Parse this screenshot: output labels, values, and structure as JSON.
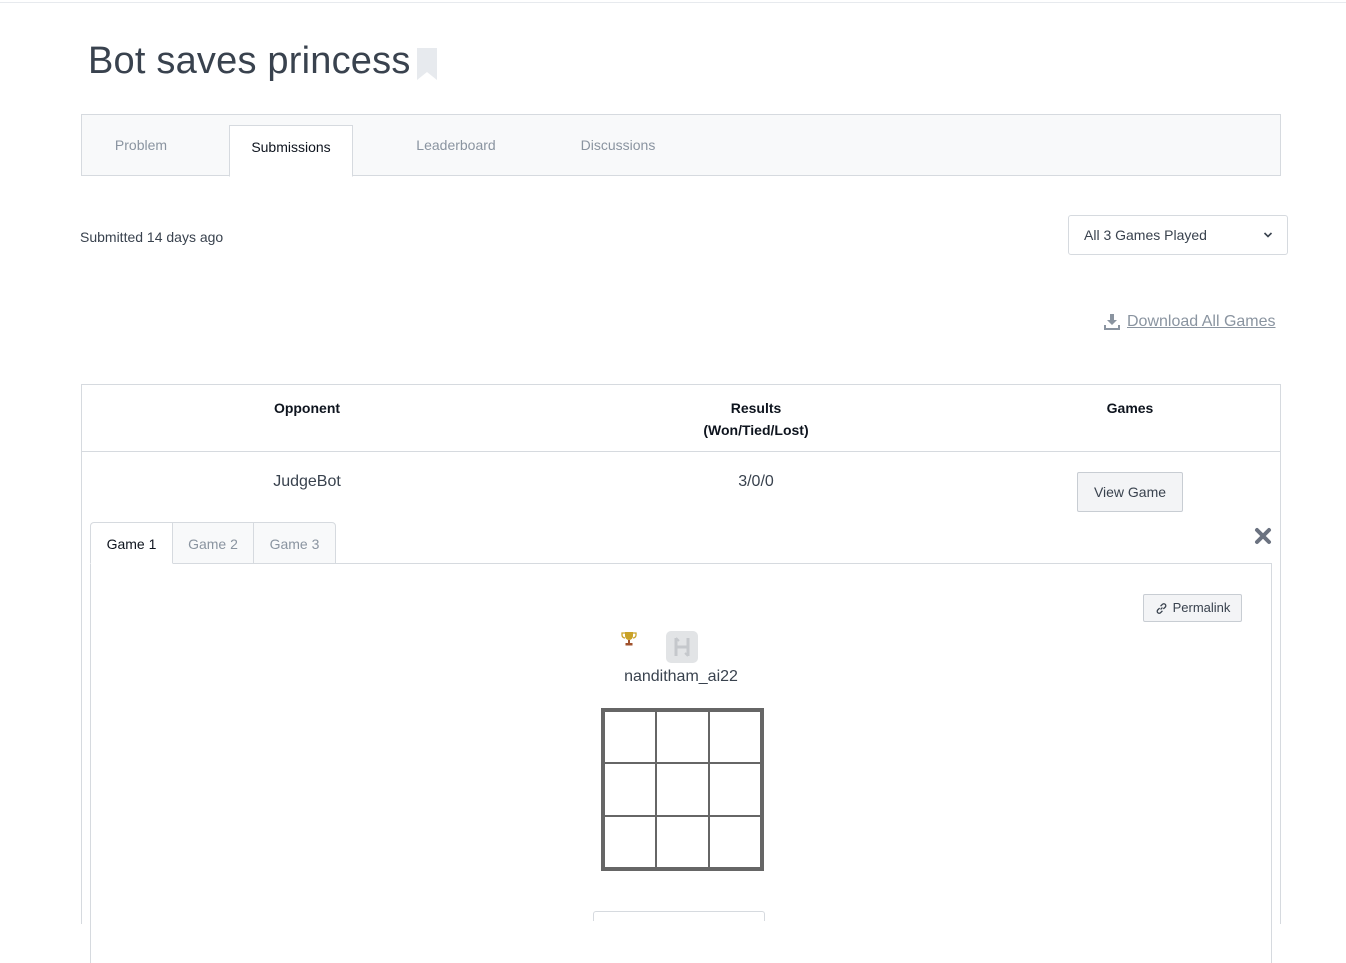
{
  "problem": {
    "title": "Bot saves princess"
  },
  "tabs": [
    {
      "label": "Problem"
    },
    {
      "label": "Submissions"
    },
    {
      "label": "Leaderboard"
    },
    {
      "label": "Discussions"
    }
  ],
  "submission": {
    "submitted_text": "Submitted 14 days ago",
    "filter_selected": "All 3 Games Played",
    "download_label": "Download All Games"
  },
  "table": {
    "headers": {
      "opponent": "Opponent",
      "results_line1": "Results",
      "results_line2": "(Won/Tied/Lost)",
      "games": "Games"
    },
    "row": {
      "opponent": "JudgeBot",
      "results": "3/0/0",
      "view_game_label": "View Game"
    }
  },
  "game_tabs": [
    {
      "label": "Game 1"
    },
    {
      "label": "Game 2"
    },
    {
      "label": "Game 3"
    }
  ],
  "game": {
    "permalink_label": "Permalink",
    "player_name": "nanditham_ai22",
    "board_cells": [
      "",
      "",
      "",
      "",
      "",
      "",
      "",
      "",
      ""
    ]
  },
  "icons": {
    "bookmark": "bookmark-icon",
    "download": "download-icon",
    "close": "close-icon",
    "link": "link-icon",
    "trophy": "trophy-icon",
    "logo": "hackerrank-logo-icon",
    "chevron": "chevron-down-icon"
  },
  "colors": {
    "text": "#39424e",
    "muted": "#8a94a0",
    "border": "#d6dadf",
    "trophy": "#c9a227"
  }
}
